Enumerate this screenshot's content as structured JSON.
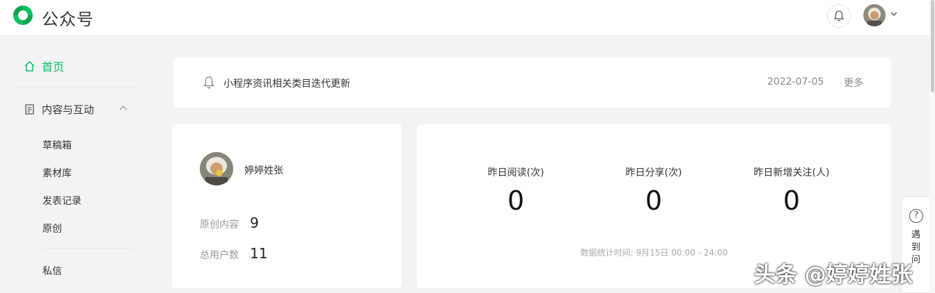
{
  "header": {
    "brand": "公众号",
    "logo_icon": "wechat-official-account-logo",
    "notification_icon": "bell-icon",
    "accent": "#07c160"
  },
  "sidebar": {
    "home_label": "首页",
    "group_label": "内容与互动",
    "items": [
      "草稿箱",
      "素材库",
      "发表记录",
      "原创"
    ],
    "messages_label": "私信"
  },
  "notice": {
    "text": "小程序资讯相关类目迭代更新",
    "date": "2022-07-05",
    "more": "更多"
  },
  "profile": {
    "name": "婷婷姓张",
    "original_label": "原创内容",
    "original_value": "9",
    "users_label": "总用户数",
    "users_value": "11"
  },
  "stats": {
    "metrics": [
      {
        "label": "昨日阅读(次)",
        "value": "0"
      },
      {
        "label": "昨日分享(次)",
        "value": "0"
      },
      {
        "label": "昨日新增关注(人)",
        "value": "0"
      }
    ],
    "footnote": "数据统计时间: 9月15日 00:00 - 24:00"
  },
  "help": {
    "icon": "?",
    "label": "遇到问"
  },
  "watermark": "头条 @婷婷姓张"
}
